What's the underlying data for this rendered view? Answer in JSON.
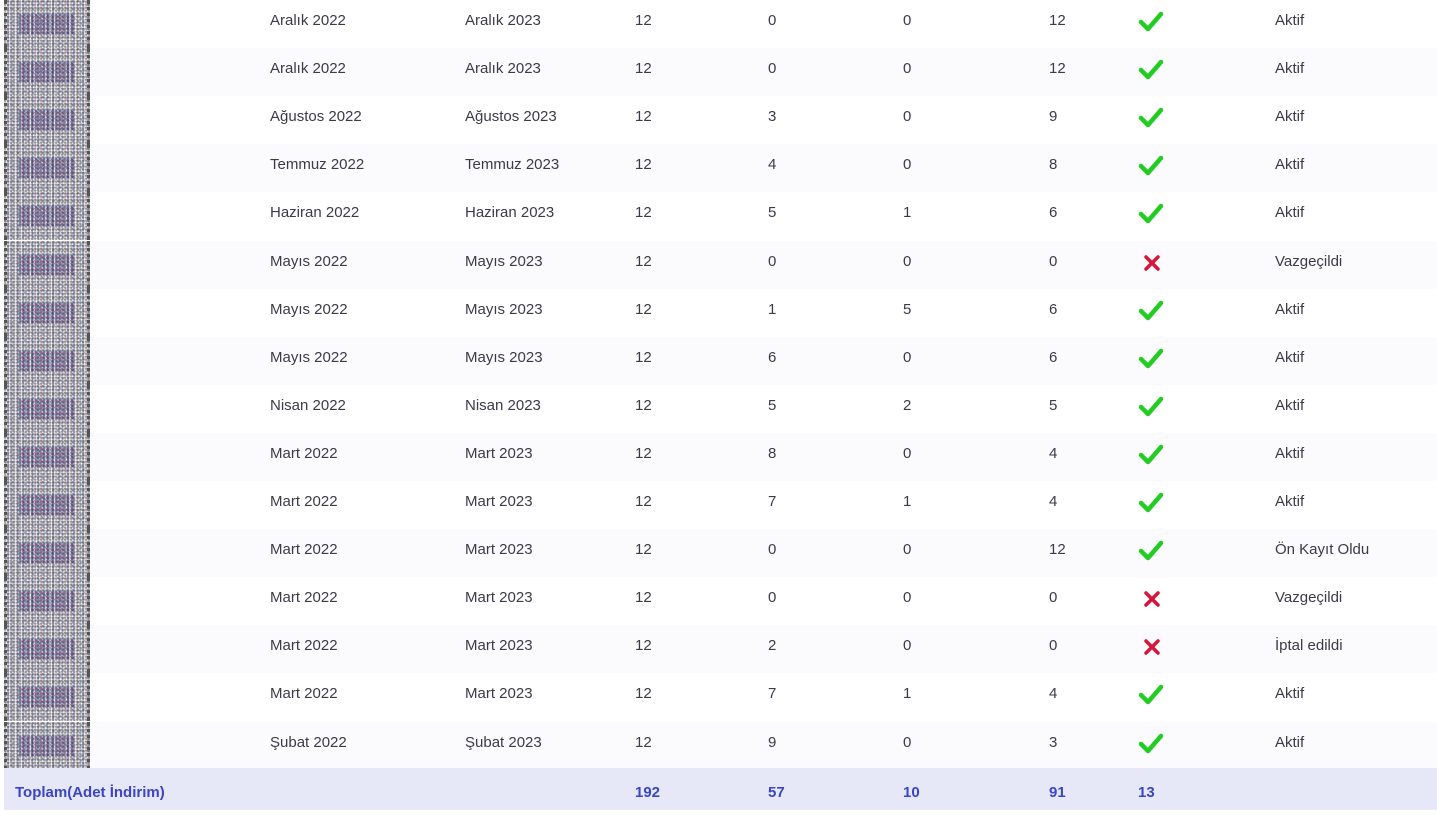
{
  "colors": {
    "check": "#22cc22",
    "cross": "#d6143c",
    "footer_bg": "#e6e8f8",
    "footer_text": "#3b45c6"
  },
  "rows": [
    {
      "start": "Aralık 2022",
      "end": "Aralık 2023",
      "n1": "12",
      "n2": "0",
      "n3": "0",
      "n4": "12",
      "icon": "check-icon",
      "status": "Aktif"
    },
    {
      "start": "Aralık 2022",
      "end": "Aralık 2023",
      "n1": "12",
      "n2": "0",
      "n3": "0",
      "n4": "12",
      "icon": "check-icon",
      "status": "Aktif"
    },
    {
      "start": "Ağustos 2022",
      "end": "Ağustos 2023",
      "n1": "12",
      "n2": "3",
      "n3": "0",
      "n4": "9",
      "icon": "check-icon",
      "status": "Aktif"
    },
    {
      "start": "Temmuz 2022",
      "end": "Temmuz 2023",
      "n1": "12",
      "n2": "4",
      "n3": "0",
      "n4": "8",
      "icon": "check-icon",
      "status": "Aktif"
    },
    {
      "start": "Haziran 2022",
      "end": "Haziran 2023",
      "n1": "12",
      "n2": "5",
      "n3": "1",
      "n4": "6",
      "icon": "check-icon",
      "status": "Aktif"
    },
    {
      "start": "Mayıs 2022",
      "end": "Mayıs 2023",
      "n1": "12",
      "n2": "0",
      "n3": "0",
      "n4": "0",
      "icon": "cross-icon",
      "status": "Vazgeçildi"
    },
    {
      "start": "Mayıs 2022",
      "end": "Mayıs 2023",
      "n1": "12",
      "n2": "1",
      "n3": "5",
      "n4": "6",
      "icon": "check-icon",
      "status": "Aktif"
    },
    {
      "start": "Mayıs 2022",
      "end": "Mayıs 2023",
      "n1": "12",
      "n2": "6",
      "n3": "0",
      "n4": "6",
      "icon": "check-icon",
      "status": "Aktif"
    },
    {
      "start": "Nisan 2022",
      "end": "Nisan 2023",
      "n1": "12",
      "n2": "5",
      "n3": "2",
      "n4": "5",
      "icon": "check-icon",
      "status": "Aktif"
    },
    {
      "start": "Mart 2022",
      "end": "Mart 2023",
      "n1": "12",
      "n2": "8",
      "n3": "0",
      "n4": "4",
      "icon": "check-icon",
      "status": "Aktif"
    },
    {
      "start": "Mart 2022",
      "end": "Mart 2023",
      "n1": "12",
      "n2": "7",
      "n3": "1",
      "n4": "4",
      "icon": "check-icon",
      "status": "Aktif"
    },
    {
      "start": "Mart 2022",
      "end": "Mart 2023",
      "n1": "12",
      "n2": "0",
      "n3": "0",
      "n4": "12",
      "icon": "check-icon",
      "status": "Ön Kayıt Oldu"
    },
    {
      "start": "Mart 2022",
      "end": "Mart 2023",
      "n1": "12",
      "n2": "0",
      "n3": "0",
      "n4": "0",
      "icon": "cross-icon",
      "status": "Vazgeçildi"
    },
    {
      "start": "Mart 2022",
      "end": "Mart 2023",
      "n1": "12",
      "n2": "2",
      "n3": "0",
      "n4": "0",
      "icon": "cross-icon",
      "status": "İptal edildi"
    },
    {
      "start": "Mart 2022",
      "end": "Mart 2023",
      "n1": "12",
      "n2": "7",
      "n3": "1",
      "n4": "4",
      "icon": "check-icon",
      "status": "Aktif"
    },
    {
      "start": "Şubat 2022",
      "end": "Şubat 2023",
      "n1": "12",
      "n2": "9",
      "n3": "0",
      "n4": "3",
      "icon": "check-icon",
      "status": "Aktif"
    }
  ],
  "footer": {
    "label": "Toplam(Adet İndirim)",
    "n1": "192",
    "n2": "57",
    "n3": "10",
    "n4": "91",
    "n5": "13"
  }
}
